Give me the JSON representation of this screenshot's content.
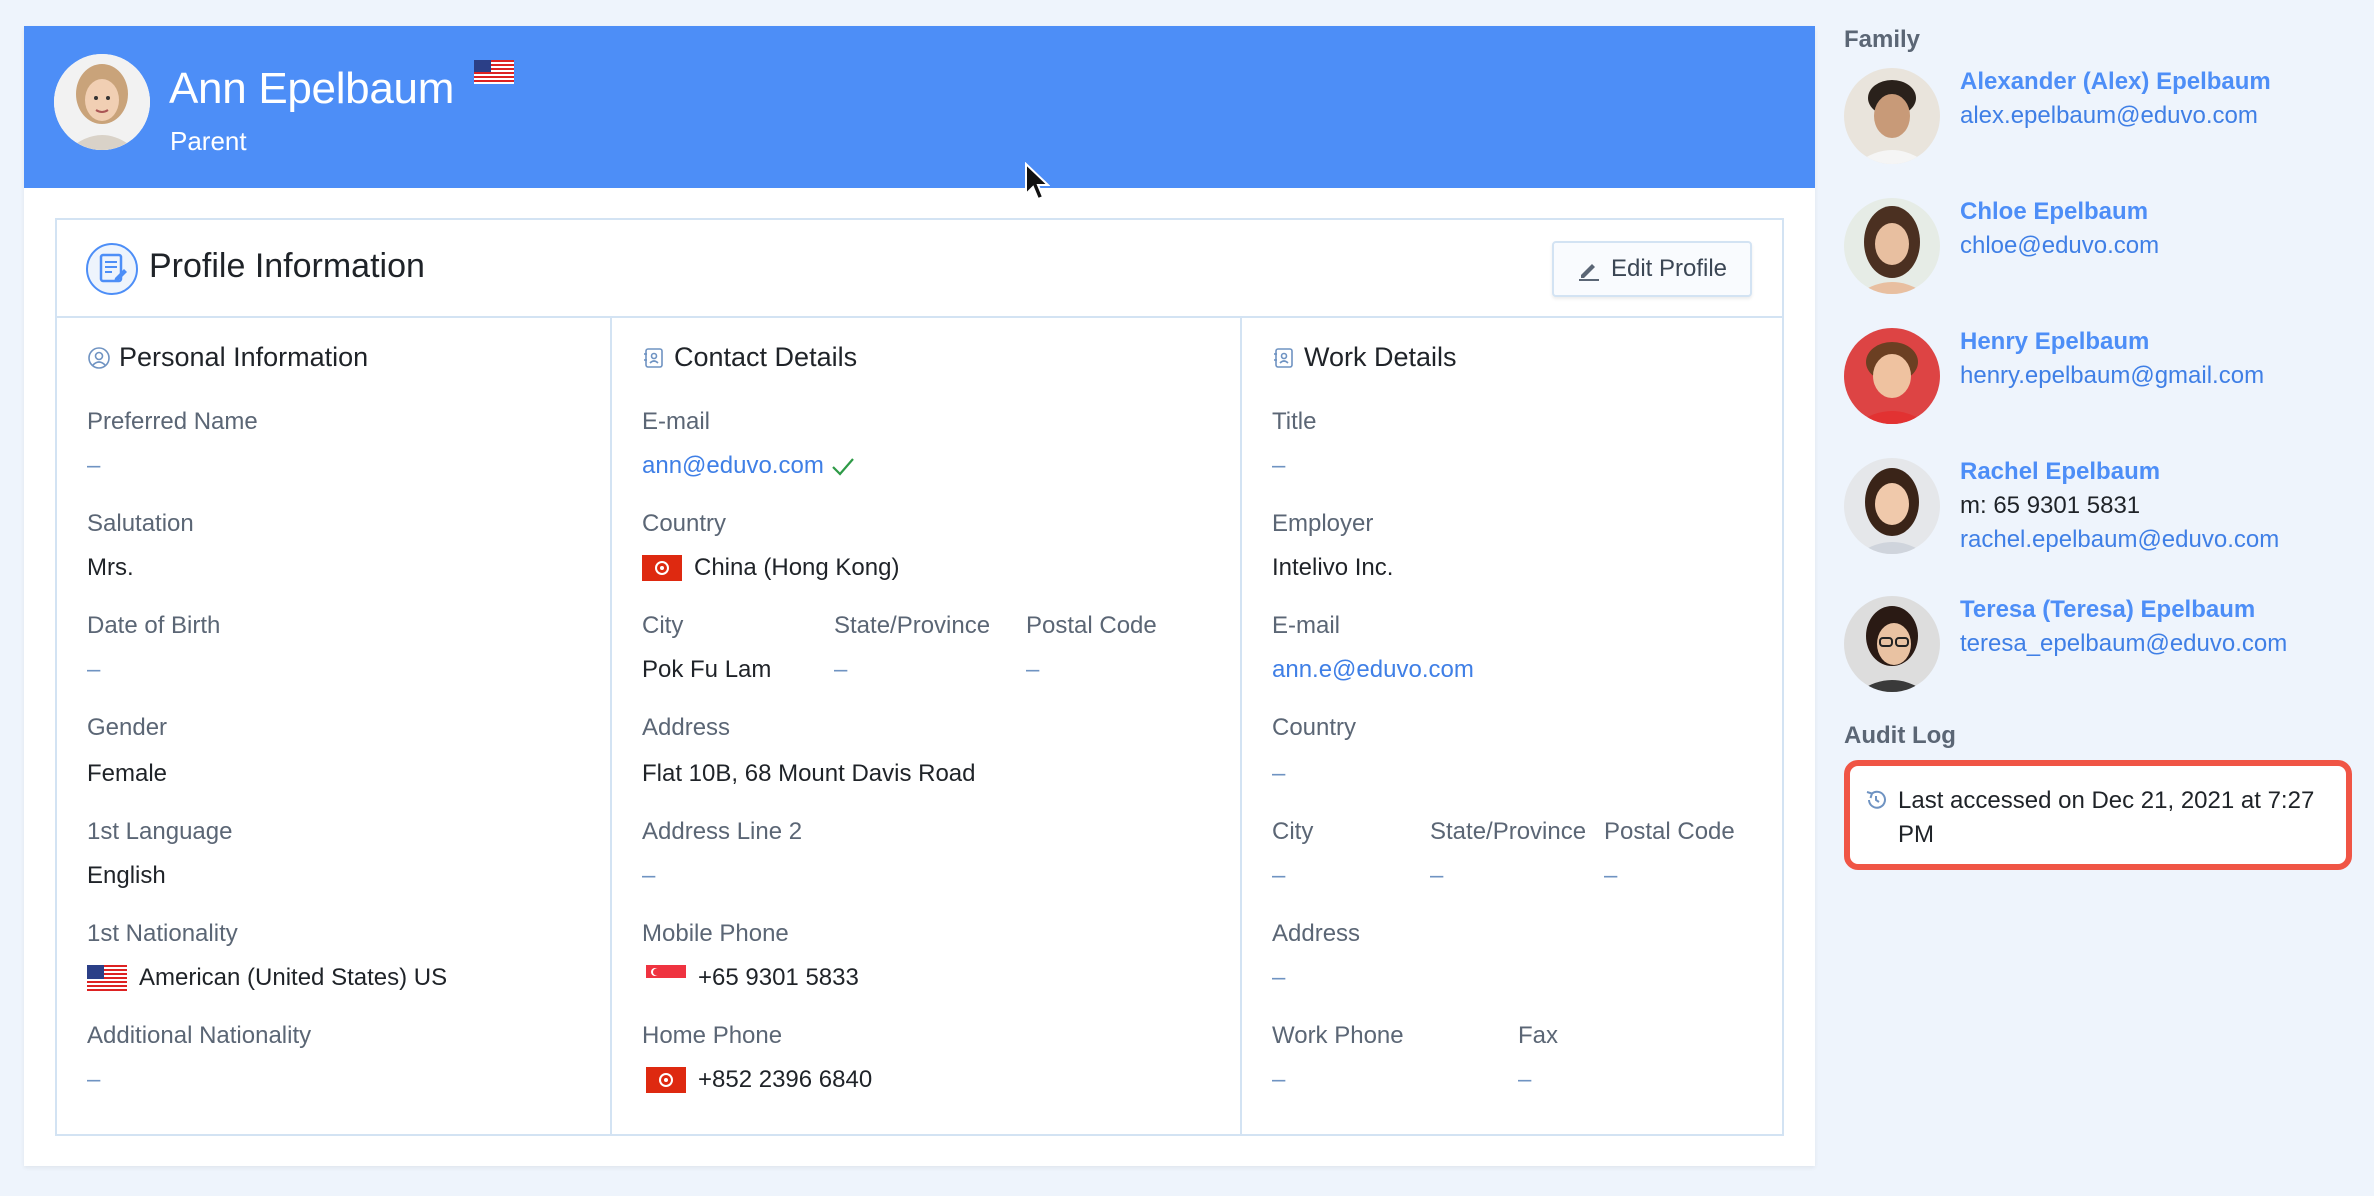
{
  "header": {
    "name": "Ann Epelbaum",
    "role": "Parent"
  },
  "profile": {
    "title": "Profile Information",
    "edit_label": "Edit Profile",
    "personal": {
      "title": "Personal Information",
      "preferred_name_label": "Preferred Name",
      "preferred_name": "–",
      "salutation_label": "Salutation",
      "salutation": "Mrs.",
      "dob_label": "Date of Birth",
      "dob": "–",
      "gender_label": "Gender",
      "gender": "Female",
      "language_label": "1st Language",
      "language": "English",
      "nationality_label": "1st Nationality",
      "nationality": "American (United States) US",
      "additional_nationality_label": "Additional Nationality",
      "additional_nationality": "–"
    },
    "contact": {
      "title": "Contact Details",
      "email_label": "E-mail",
      "email": "ann@eduvo.com",
      "country_label": "Country",
      "country": "China (Hong Kong)",
      "city_label": "City",
      "city": "Pok Fu Lam",
      "state_label": "State/Province",
      "state": "–",
      "postal_label": "Postal Code",
      "postal": "–",
      "address_label": "Address",
      "address": "Flat 10B, 68 Mount Davis Road",
      "address2_label": "Address Line 2",
      "address2": "–",
      "mobile_label": "Mobile Phone",
      "mobile": "+65 9301 5833",
      "home_label": "Home Phone",
      "home": "+852 2396 6840"
    },
    "work": {
      "title": "Work Details",
      "title_label": "Title",
      "title_value": "–",
      "employer_label": "Employer",
      "employer": "Intelivo Inc.",
      "email_label": "E-mail",
      "email": "ann.e@eduvo.com",
      "country_label": "Country",
      "country": "–",
      "city_label": "City",
      "city": "–",
      "state_label": "State/Province",
      "state": "–",
      "postal_label": "Postal Code",
      "postal": "–",
      "address_label": "Address",
      "address": "–",
      "work_phone_label": "Work Phone",
      "work_phone": "–",
      "fax_label": "Fax",
      "fax": "–"
    }
  },
  "family": {
    "heading": "Family",
    "members": [
      {
        "name": "Alexander (Alex) Epelbaum",
        "email": "alex.epelbaum@eduvo.com"
      },
      {
        "name": "Chloe Epelbaum",
        "email": "chloe@eduvo.com"
      },
      {
        "name": "Henry Epelbaum",
        "email": "henry.epelbaum@gmail.com"
      },
      {
        "name": "Rachel Epelbaum",
        "phone": "m: 65 9301 5831",
        "email": "rachel.epelbaum@eduvo.com"
      },
      {
        "name": "Teresa (Teresa) Epelbaum",
        "email": "teresa_epelbaum@eduvo.com"
      }
    ]
  },
  "audit": {
    "heading": "Audit Log",
    "text": "Last accessed on Dec 21, 2021 at 7:27 PM"
  },
  "colors": {
    "header_bg": "#4d8ef7",
    "link": "#3f7fe6",
    "audit_highlight": "#f05545"
  }
}
